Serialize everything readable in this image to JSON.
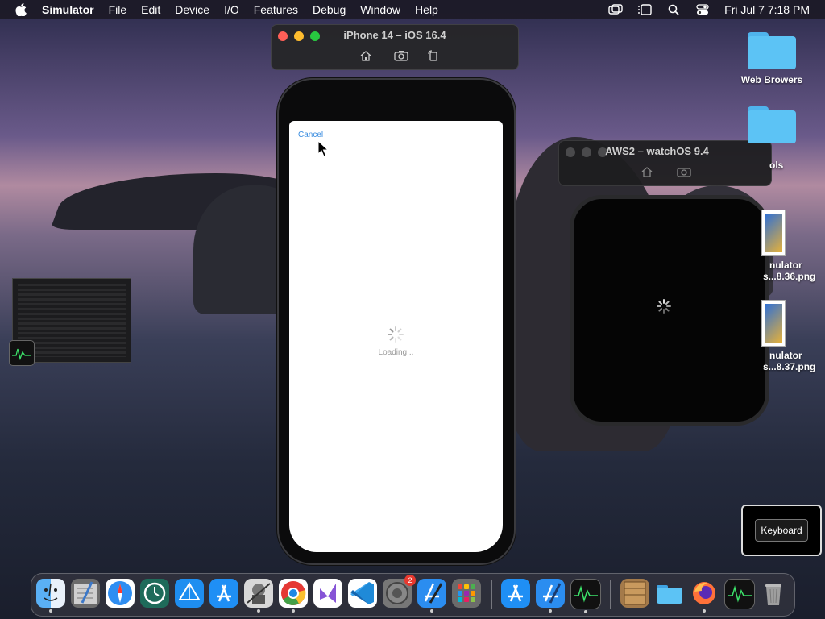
{
  "menubar": {
    "app_name": "Simulator",
    "items": [
      "File",
      "Edit",
      "Device",
      "I/O",
      "Features",
      "Debug",
      "Window",
      "Help"
    ],
    "clock": "Fri Jul 7  7:18 PM"
  },
  "iphone_window": {
    "title": "iPhone 14 – iOS 16.4",
    "screen": {
      "cancel_label": "Cancel",
      "loading_label": "Loading..."
    }
  },
  "watch_window": {
    "title": "AWS2 – watchOS 9.4"
  },
  "desktop": {
    "icons": [
      {
        "label": "Web Browers",
        "kind": "folder"
      },
      {
        "label": "ols",
        "kind": "folder"
      },
      {
        "label_line1": "nulator",
        "label_line2": "s...8.36.png",
        "kind": "screenshot"
      },
      {
        "label_line1": "nulator",
        "label_line2": "s...8.37.png",
        "kind": "screenshot"
      }
    ]
  },
  "keyboard_popup": {
    "label": "Keyboard"
  },
  "dock": {
    "apps": [
      "finder",
      "script-editor",
      "safari",
      "time-machine",
      "testflight-like",
      "app-store",
      "automator",
      "chrome",
      "visual-studio",
      "vscode",
      "system-preferences",
      "xcode-simulator",
      "launchpad",
      "app-store-2",
      "xcode",
      "activity-monitor",
      "archive-utility",
      "folder",
      "firefox",
      "activity-monitor-2",
      "trash"
    ],
    "system_preferences_badge": "2"
  },
  "colors": {
    "accent": "#3a8de0",
    "red": "#ff5f57",
    "yellow": "#febc2e",
    "green": "#28c840"
  }
}
